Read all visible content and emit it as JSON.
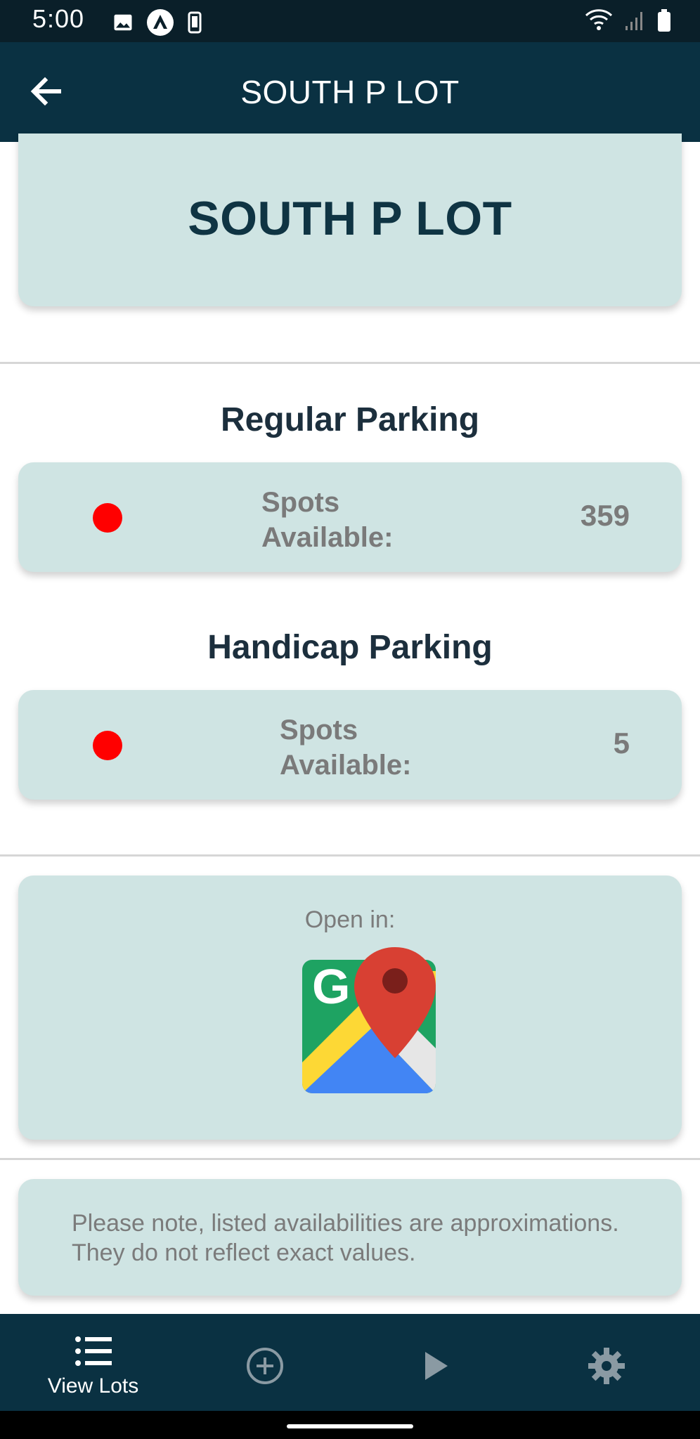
{
  "status_bar": {
    "time": "5:00",
    "left_icons": [
      "image-icon",
      "app-logo-icon",
      "phone-icon"
    ],
    "right_icons": [
      "wifi-icon",
      "signal-icon",
      "battery-icon"
    ]
  },
  "app_bar": {
    "title": "SOUTH P LOT",
    "back_icon": "arrow-left-icon"
  },
  "lot": {
    "name": "SOUTH P LOT"
  },
  "regular": {
    "heading": "Regular Parking",
    "label": "Spots Available:",
    "value": "359",
    "status_color": "#ff0000"
  },
  "handicap": {
    "heading": "Handicap Parking",
    "label": "Spots Available:",
    "value": "5",
    "status_color": "#ff0000"
  },
  "maps": {
    "open_in_label": "Open in:",
    "app_icon": "google-maps-icon"
  },
  "note": {
    "text": "Please note, listed availabilities are approximations. They do not reflect exact values."
  },
  "bottom_nav": {
    "items": [
      {
        "label": "View Lots",
        "icon": "list-icon",
        "active": true
      },
      {
        "label": "",
        "icon": "add-circle-icon",
        "active": false
      },
      {
        "label": "",
        "icon": "play-icon",
        "active": false
      },
      {
        "label": "",
        "icon": "gear-icon",
        "active": false
      }
    ]
  },
  "colors": {
    "app_bar": "#0a3142",
    "card": "#cfe4e3",
    "status_available": "#ff0000",
    "heading_text": "#1c2f3d"
  }
}
